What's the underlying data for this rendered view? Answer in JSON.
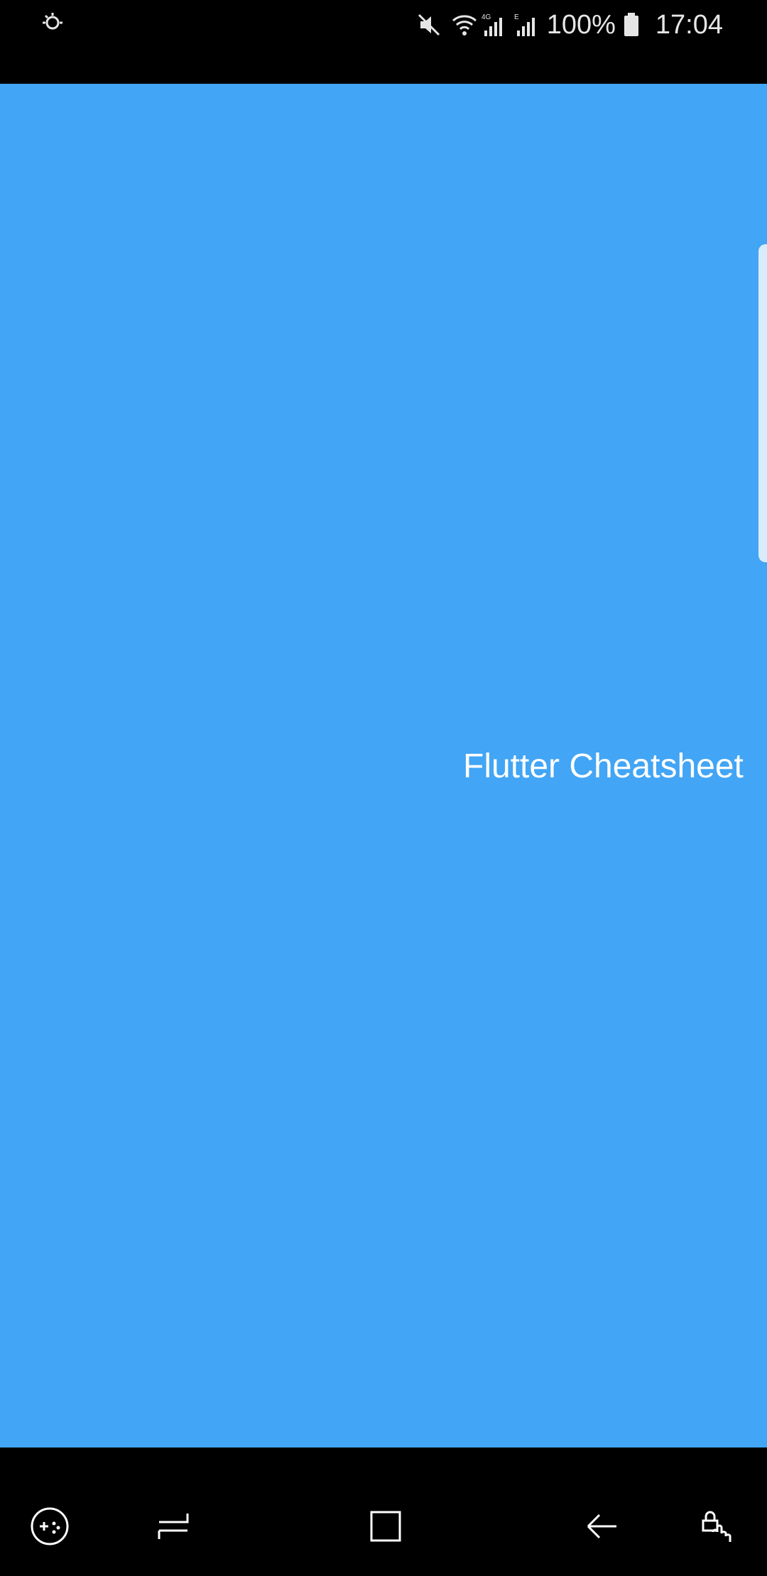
{
  "status_bar": {
    "battery_percent": "100%",
    "time": "17:04",
    "icons": [
      "location-icon",
      "mute-icon",
      "wifi-icon",
      "signal-4g-icon",
      "signal-e-icon",
      "battery-icon"
    ]
  },
  "main": {
    "background_color": "#42a5f5",
    "title": "Flutter Cheatsheet"
  },
  "nav_bar": {
    "buttons": [
      "game-tools-button",
      "recents-button",
      "home-button",
      "back-button",
      "touch-lock-button"
    ]
  }
}
